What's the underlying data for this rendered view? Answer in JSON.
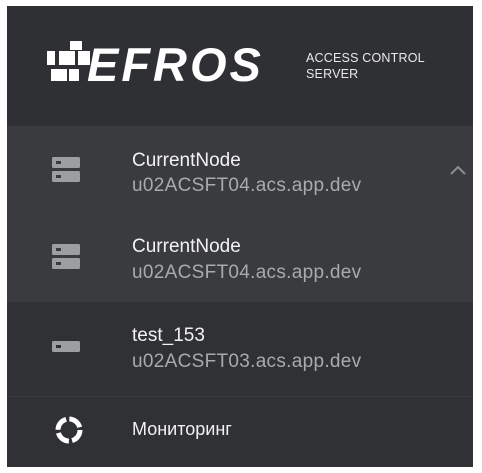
{
  "brand": {
    "logo_text": "EFROS",
    "subtitle_line1": "ACCESS CONTROL",
    "subtitle_line2": "SERVER"
  },
  "nodes": [
    {
      "name": "CurrentNode",
      "host": "u02ACSFT04.acs.app.dev",
      "icon": "server-icon",
      "expanded": true
    },
    {
      "name": "CurrentNode",
      "host": "u02ACSFT04.acs.app.dev",
      "icon": "server-icon"
    },
    {
      "name": "test_153",
      "host": "u02ACSFT03.acs.app.dev",
      "icon": "server-single-icon"
    }
  ],
  "menu": {
    "monitoring_label": "Мониторинг",
    "monitoring_icon": "monitoring-ring-icon"
  },
  "colors": {
    "panel_bg": "#303134",
    "selected_bg": "#3a3b3f",
    "text_primary": "#f2f2f2",
    "text_secondary": "#a9aaad"
  }
}
